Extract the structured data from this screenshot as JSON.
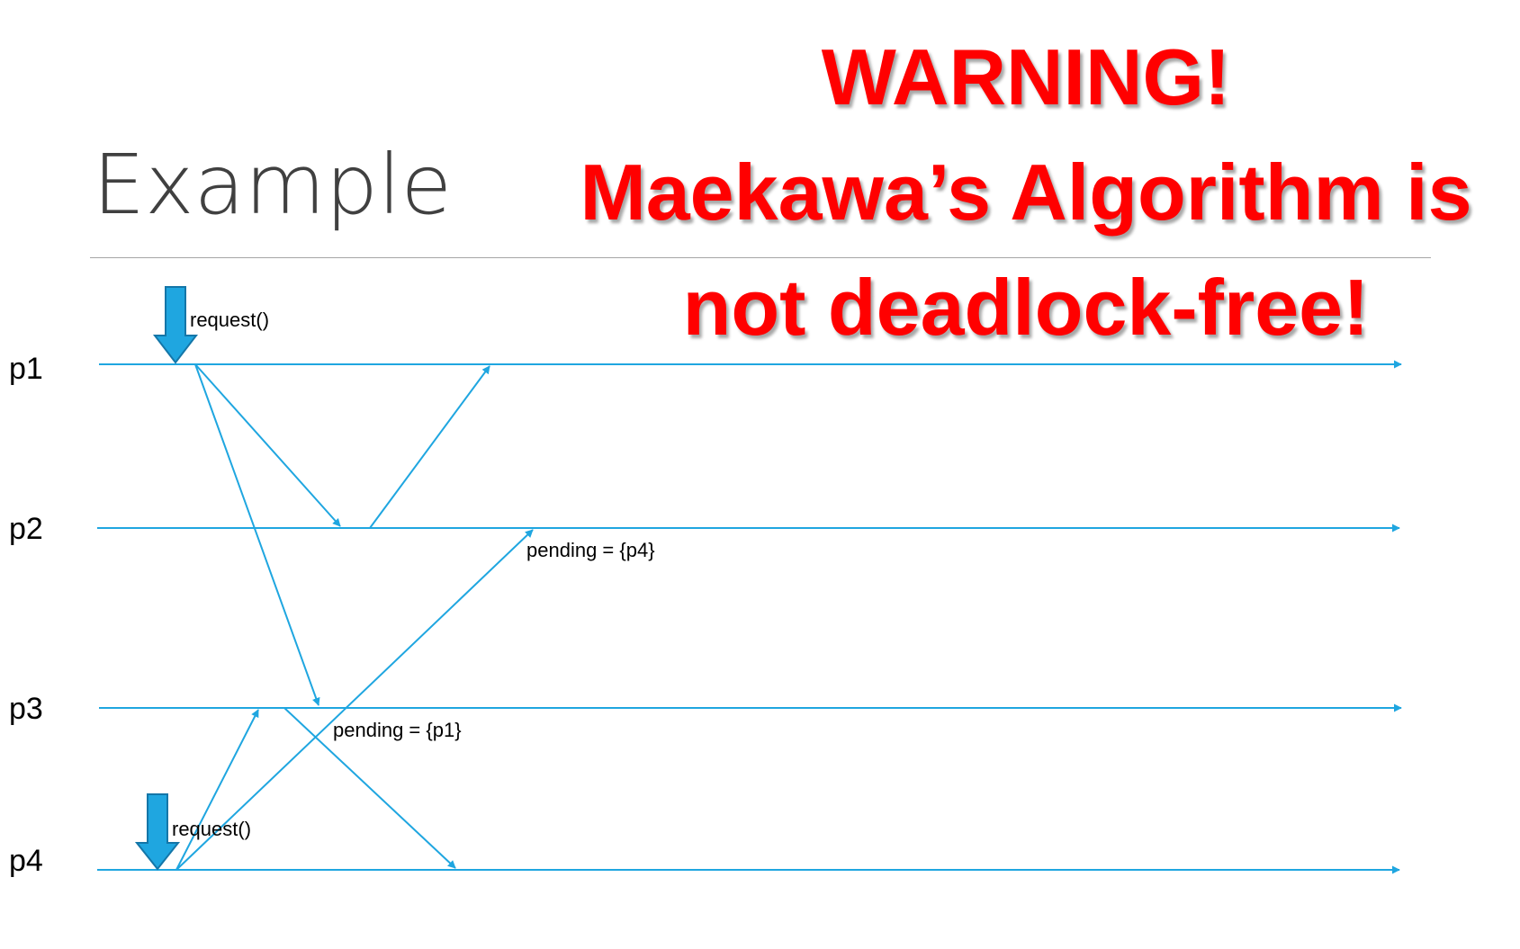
{
  "slide": {
    "title": "Example"
  },
  "warning": {
    "line1": "WARNING!",
    "line2": "Maekawa’s Algorithm is",
    "line3": "not deadlock-free!"
  },
  "processes": [
    "p1",
    "p2",
    "p3",
    "p4"
  ],
  "events": {
    "p1_request": "request()",
    "p4_request": "request()"
  },
  "annotations": {
    "p2_pending": "pending = {p4}",
    "p3_pending": "pending = {p1}"
  },
  "colors": {
    "timeline": "#1fa6e0",
    "request_arrow": "#1fa6e0",
    "warning_text": "#ff0000",
    "title_text": "#404040"
  }
}
